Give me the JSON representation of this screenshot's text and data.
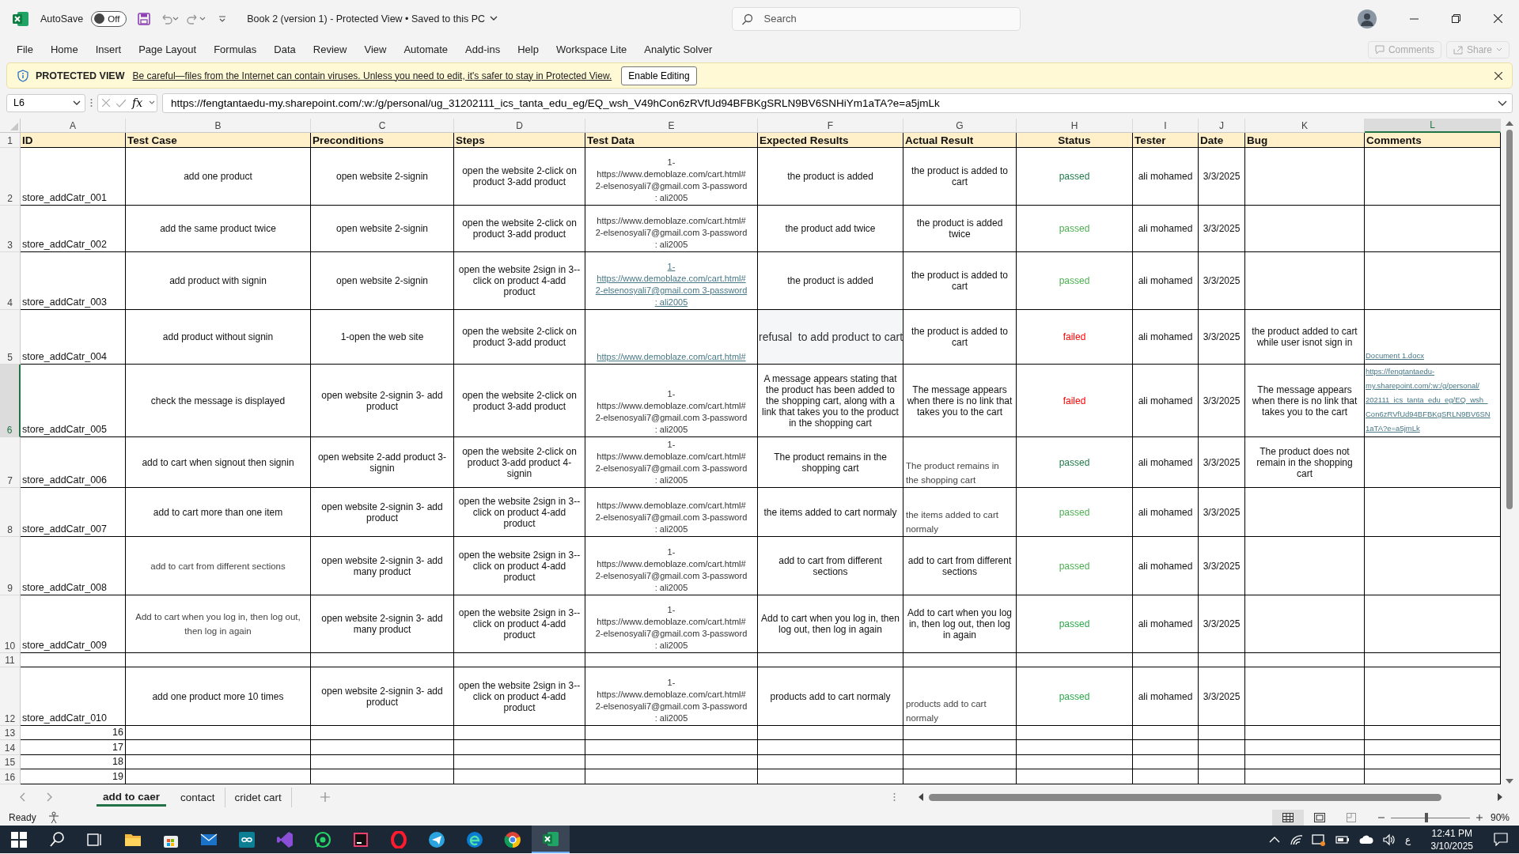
{
  "title_bar": {
    "autosave": {
      "label": "AutoSave",
      "state_label": "Off",
      "on": false
    },
    "title": "Book 2 (version 1)  -  Protected View  •  Saved to this PC",
    "search": {
      "placeholder": "Search"
    }
  },
  "menu": [
    "File",
    "Home",
    "Insert",
    "Page Layout",
    "Formulas",
    "Data",
    "Review",
    "View",
    "Automate",
    "Add-ins",
    "Help",
    "Workspace Lite",
    "Analytic Solver"
  ],
  "menu_buttons": [
    "Comments",
    "Share"
  ],
  "protected_view": {
    "label": "PROTECTED VIEW",
    "message": "Be careful—files from the Internet can contain viruses. Unless you need to edit, it's safer to stay in Protected View.",
    "button": "Enable Editing"
  },
  "formula_bar": {
    "name_box": "L6",
    "function_label": "fx",
    "value": "https://fengtantaedu-my.sharepoint.com/:w:/g/personal/ug_31202111_ics_tanta_edu_eg/EQ_wsh_V49hCon6zRVfUd94BFBKgSRLN9BV6SNHiYm1aTA?e=a5jmLk"
  },
  "sheet": {
    "columns": [
      {
        "label": "A",
        "selected": false
      },
      {
        "label": "B",
        "selected": false
      },
      {
        "label": "C",
        "selected": false
      },
      {
        "label": "D",
        "selected": false
      },
      {
        "label": "E",
        "selected": false
      },
      {
        "label": "F",
        "selected": false
      },
      {
        "label": "G",
        "selected": false
      },
      {
        "label": "H",
        "selected": false
      },
      {
        "label": "I",
        "selected": false
      },
      {
        "label": "J",
        "selected": false
      },
      {
        "label": "K",
        "selected": false
      },
      {
        "label": "L",
        "selected": true
      }
    ],
    "header_row": {
      "number": "1",
      "selected": false,
      "headings": [
        "ID",
        "Test Case",
        "Preconditions",
        "Steps",
        "Test Data",
        "Expected Results",
        "Actual Result",
        "Status",
        "Tester",
        "Date",
        "Bug",
        "Comments"
      ]
    },
    "rows": [
      {
        "number": "2",
        "selected": false,
        "id": "store_addCatr_001",
        "test_case": "add one product",
        "preconditions": "open website 2-signin",
        "steps": "open the website 2-click on product 3-add product",
        "test_data": {
          "lines": [
            "1-",
            "https://www.demoblaze.com/cart.html#",
            "2-elsenosyali7@gmail.com 3-password",
            ": ali2005"
          ]
        },
        "expected": "the product is added",
        "actual": "the product is added to cart",
        "status": {
          "kind": "status",
          "text": "passed",
          "color": "#1f7a4a"
        },
        "tester": "ali mohamed",
        "date": "3/3/2025"
      },
      {
        "number": "3",
        "selected": false,
        "id": "store_addCatr_002",
        "test_case": "add the same product twice",
        "preconditions": "open website 2-signin",
        "steps": "open the website 2-click on product 3-add product",
        "test_data": {
          "lines": [
            "https://www.demoblaze.com/cart.html#",
            "2-elsenosyali7@gmail.com 3-password",
            ": ali2005"
          ]
        },
        "expected": "the product add twice",
        "actual": "the product is added twice",
        "status": {
          "kind": "status",
          "text": "passed",
          "color": "#4caf50"
        },
        "tester": "ali mohamed",
        "date": "3/3/2025"
      },
      {
        "number": "4",
        "selected": false,
        "id": "store_addCatr_003",
        "test_case": "add product with signin",
        "preconditions": "open website 2-signin",
        "steps": "open the website 2sign in 3--click on product 4-add product",
        "test_data": {
          "kind": "link",
          "lines": [
            "1-",
            "https://www.demoblaze.com/cart.html#",
            "2-elsenosyali7@gmail.com 3-password",
            ": ali2005"
          ]
        },
        "expected": "the product is added",
        "actual": "the product is added to cart",
        "status": {
          "kind": "status",
          "text": "passed",
          "color": "#4caf50"
        },
        "tester": "ali mohamed",
        "date": "3/3/2025"
      },
      {
        "number": "5",
        "selected": false,
        "id": "store_addCatr_004",
        "test_case": "add product without signin",
        "preconditions": "1-open the web site",
        "steps": "open the website 2-click on product 3-add product",
        "test_data": {
          "kind": "link",
          "lines": [
            "https://www.demoblaze.com/cart.html#"
          ]
        },
        "expected": {
          "kind": "large",
          "text": "refusal  to add product to cart"
        },
        "actual": "the product is added to cart",
        "status": {
          "kind": "status",
          "text": "failed",
          "color": "#ff0000"
        },
        "tester": "ali mohamed",
        "date": "3/3/2025",
        "bug": "the product added to cart while user isnot sign in",
        "comments": {
          "kind": "link",
          "lines": [
            "Document 1.docx"
          ]
        }
      },
      {
        "number": "6",
        "selected": true,
        "id": "store_addCatr_005",
        "test_case": "check the message is displayed",
        "preconditions": "open website 2-signin  3- add product",
        "steps": "open the website 2-click on product 3-add product",
        "test_data": {
          "lines": [
            "1-",
            "https://www.demoblaze.com/cart.html#",
            "2-elsenosyali7@gmail.com 3-password",
            ": ali2005"
          ]
        },
        "expected": "A message appears stating that the product has been added to the shopping cart, along with a link that takes you to the product in the shopping cart",
        "actual": "The message appears when there is no link that takes you to the cart",
        "status": {
          "kind": "status",
          "text": "failed",
          "color": "#ff0000"
        },
        "tester": "ali mohamed",
        "date": "3/3/2025",
        "bug": "The message appears when there is no link that takes you to the cart",
        "comments": {
          "kind": "link",
          "lines": [
            "https://fengtantaedu-",
            "my.sharepoint.com/:w:/g/personal/",
            "202111_ics_tanta_edu_eg/EQ_wsh_",
            "Con6zRVfUd94BFBKgSRLN9BV6SN",
            "1aTA?e=a5jmLk"
          ]
        }
      },
      {
        "number": "7",
        "selected": false,
        "id": "store_addCatr_006",
        "test_case": "add to cart when signout then signin",
        "preconditions": "open website 2-add product  3-signin",
        "steps": "open the website 2-click on product 3-add product 4-signin",
        "test_data": {
          "lines": [
            "1-",
            "https://www.demoblaze.com/cart.html#",
            "2-elsenosyali7@gmail.com 3-password",
            ": ali2005"
          ]
        },
        "expected": "The product remains in the shopping cart",
        "actual": {
          "kind": "note",
          "text": "The product remains in the shopping cart"
        },
        "status": {
          "kind": "status",
          "text": "passed",
          "color": "#1f7a4a"
        },
        "tester": "ali mohamed",
        "date": "3/3/2025",
        "bug": "The product does not remain in the shopping cart"
      },
      {
        "number": "8",
        "selected": false,
        "id": "store_addCatr_007",
        "test_case": "add to cart more than one item",
        "preconditions": "open website 2-signin  3- add product",
        "steps": "open the website 2sign in 3--click on product 4-add product",
        "test_data": {
          "lines": [
            "https://www.demoblaze.com/cart.html#",
            "2-elsenosyali7@gmail.com 3-password",
            ": ali2005"
          ]
        },
        "expected": "the items added to cart normaly",
        "actual": {
          "kind": "note",
          "text": "the items added to cart normaly"
        },
        "status": {
          "kind": "status",
          "text": "passed",
          "color": "#4caf50"
        },
        "tester": "ali mohamed",
        "date": "3/3/2025"
      },
      {
        "number": "9",
        "selected": false,
        "id": "store_addCatr_008",
        "test_case": {
          "kind": "note",
          "text": "add to cart from different sections"
        },
        "preconditions": "open website 2-signin  3- add many product",
        "steps": "open the website 2sign in 3--click on product 4-add product",
        "test_data": {
          "lines": [
            "1-",
            "https://www.demoblaze.com/cart.html#",
            "2-elsenosyali7@gmail.com 3-password",
            ": ali2005"
          ]
        },
        "expected": "add to cart from different sections",
        "actual": "add to cart from different sections",
        "status": {
          "kind": "status",
          "text": "passed",
          "color": "#4caf50"
        },
        "tester": "ali mohamed",
        "date": "3/3/2025"
      },
      {
        "number": "10",
        "selected": false,
        "id": "store_addCatr_009",
        "test_case": {
          "kind": "note",
          "text": "Add to cart when you log in, then log out, then log in again"
        },
        "preconditions": "open website 2-signin  3- add many product",
        "steps": "open the website 2sign in 3--click on product 4-add product",
        "test_data": {
          "lines": [
            "1-",
            "https://www.demoblaze.com/cart.html#",
            "2-elsenosyali7@gmail.com 3-password",
            ": ali2005"
          ]
        },
        "expected": "Add to cart when you log in, then log out, then log in again",
        "actual": "Add to cart when you log in, then log out, then log in again",
        "status": {
          "kind": "status",
          "text": "passed",
          "color": "#2ba84a"
        },
        "tester": "ali mohamed",
        "date": "3/3/2025"
      },
      {
        "number": "11",
        "selected": false
      },
      {
        "number": "12",
        "selected": false,
        "id": "store_addCatr_010",
        "test_case": "add one product more 10 times",
        "preconditions": "open website 2-signin  3- add product",
        "steps": "open the website 2sign in 3--click on product 4-add product",
        "test_data": {
          "lines": [
            "1-",
            "https://www.demoblaze.com/cart.html#",
            "2-elsenosyali7@gmail.com 3-password",
            ": ali2005"
          ]
        },
        "expected": "products add to cart normaly",
        "actual": {
          "kind": "note",
          "text": "products add to cart normaly"
        },
        "status": {
          "kind": "status",
          "text": "passed",
          "color": "#2ba84a"
        },
        "tester": "ali mohamed",
        "date": "3/3/2025"
      },
      {
        "number": "13",
        "selected": false,
        "id": {
          "kind": "number",
          "text": "16"
        }
      },
      {
        "number": "14",
        "selected": false,
        "id": {
          "kind": "number",
          "text": "17"
        }
      },
      {
        "number": "15",
        "selected": false,
        "id": {
          "kind": "number",
          "text": "18"
        }
      },
      {
        "number": "16",
        "selected": false,
        "id": {
          "kind": "number",
          "text": "19"
        }
      }
    ]
  },
  "sheet_tabs": [
    {
      "label": "add to caer",
      "selected": true
    },
    {
      "label": "contact",
      "selected": false
    },
    {
      "label": "cridet cart",
      "selected": false
    }
  ],
  "status_bar": {
    "status": "Ready",
    "zoom": {
      "level": 0.45,
      "reading": "90%"
    }
  },
  "taskbar": {
    "language": "ع",
    "time": "12:41 PM",
    "date": "3/10/2025"
  }
}
